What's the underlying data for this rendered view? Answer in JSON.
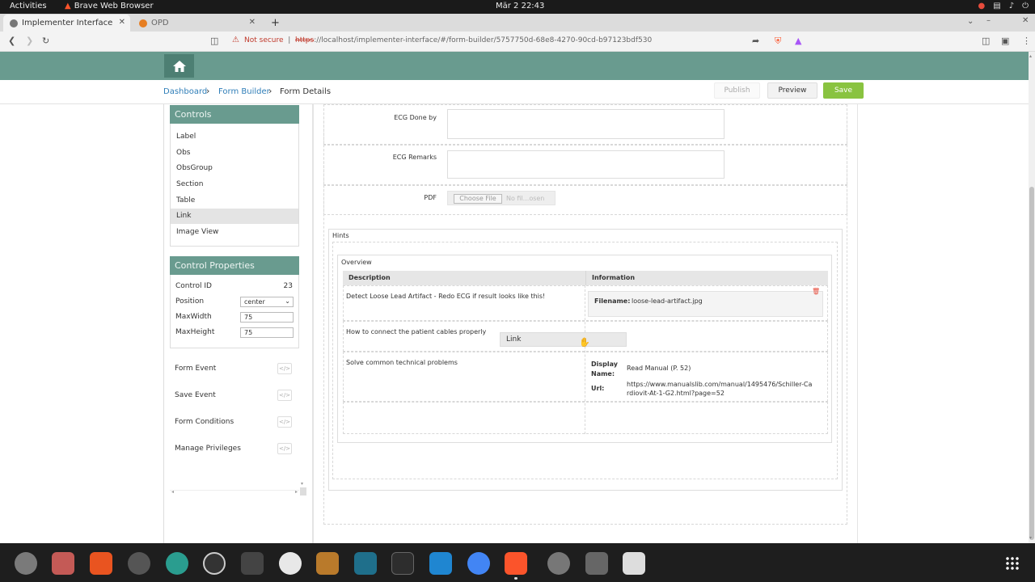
{
  "system": {
    "activities": "Activities",
    "app_name": "Brave Web Browser",
    "clock": "Mär 2  22:43"
  },
  "browser": {
    "tabs": [
      {
        "label": "Implementer Interface",
        "active": true
      },
      {
        "label": "OPD",
        "active": false
      }
    ],
    "not_secure": "Not secure",
    "url_scheme": "https",
    "url_rest": "://localhost/implementer-interface/#/form-builder/5757750d-68e8-4270-90cd-b97123bdf530"
  },
  "breadcrumb": {
    "dashboard": "Dashboard",
    "form_builder": "Form Builder",
    "current": "Form Details"
  },
  "toolbar": {
    "publish": "Publish",
    "preview": "Preview",
    "save": "Save"
  },
  "controls": {
    "title": "Controls",
    "items": [
      "Label",
      "Obs",
      "ObsGroup",
      "Section",
      "Table",
      "Link",
      "Image View"
    ],
    "selected": "Link"
  },
  "properties": {
    "title": "Control Properties",
    "control_id_label": "Control ID",
    "control_id": "23",
    "position_label": "Position",
    "position": "center",
    "maxwidth_label": "MaxWidth",
    "maxwidth": "75",
    "maxheight_label": "MaxHeight",
    "maxheight": "75"
  },
  "events": {
    "form_event": "Form Event",
    "save_event": "Save Event",
    "form_conditions": "Form Conditions",
    "manage_privileges": "Manage Privileges",
    "icon_text": "</>"
  },
  "form": {
    "ecg_done_by": "ECG Done by",
    "ecg_remarks": "ECG Remarks",
    "pdf": "PDF",
    "choose_file": "Choose File",
    "no_file": "No fil...osen",
    "hints": "Hints",
    "overview": "Overview",
    "col_description": "Description",
    "col_information": "Information",
    "row1_desc": "Detect Loose Lead Artifact - Redo ECG if result looks like this!",
    "filename_label": "Filename:",
    "filename": "loose-lead-artifact.jpg",
    "row2_desc": "How to connect the patient cables properly",
    "drag_label": "Link",
    "row3_desc": "Solve common technical problems",
    "display_name_label": "Display Name:",
    "display_name": "Read Manual (P. 52)",
    "url_label": "Url:",
    "url": "https://www.manualslib.com/manual/1495476/Schiller-Cardiovit-At-1-G2.html?page=52"
  }
}
